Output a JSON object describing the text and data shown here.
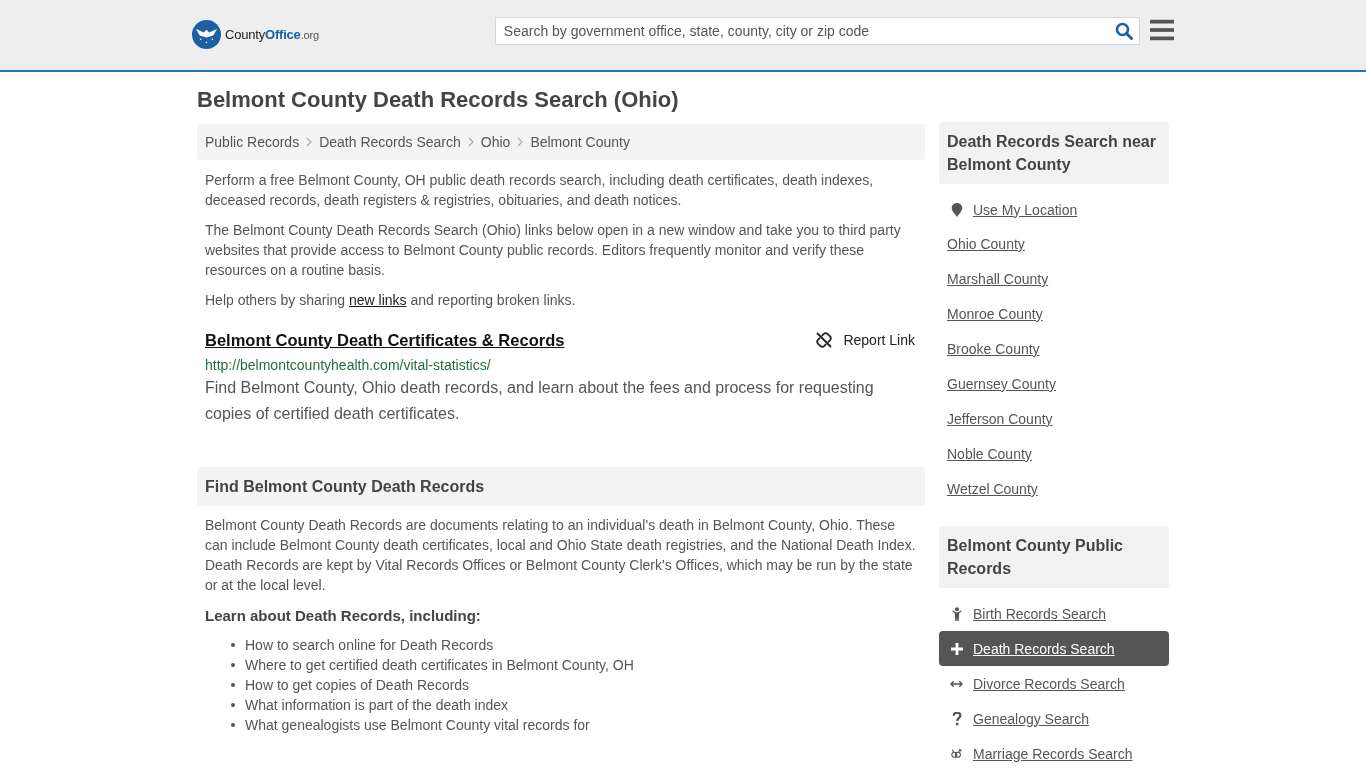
{
  "header": {
    "logo": {
      "parts": [
        {
          "text": "County",
          "kind": "plain"
        },
        {
          "text": "Office",
          "kind": "accent"
        },
        {
          "text": ".org",
          "kind": "suffix"
        }
      ]
    },
    "search": {
      "placeholder": "Search by government office, state, county, city or zip code"
    }
  },
  "page_title": "Belmont County Death Records Search (Ohio)",
  "breadcrumb": [
    "Public Records",
    "Death Records Search",
    "Ohio",
    "Belmont County"
  ],
  "intro": {
    "paragraphs": [
      "Perform a free Belmont County, OH public death records search, including death certificates, death indexes, deceased records, death registers & registries, obituaries, and death notices.",
      "The Belmont County Death Records Search (Ohio) links below open in a new window and take you to third party websites that provide access to Belmont County public records. Editors frequently monitor and verify these resources on a routine basis."
    ],
    "share_note": {
      "before": "Help others by sharing ",
      "link": "new links",
      "after": " and reporting broken links."
    }
  },
  "resources": [
    {
      "title": "Belmont County Death Certificates & Records",
      "url": "http://belmontcountyhealth.com/vital-statistics/",
      "description": "Find Belmont County, Ohio death records, and learn about the fees and process for requesting copies of certified death certificates.",
      "report_label": "Report Link"
    }
  ],
  "about": {
    "heading": "Find Belmont County Death Records",
    "paragraph": "Belmont County Death Records are documents relating to an individual's death in Belmont County, Ohio. These can include Belmont County death certificates, local and Ohio State death registries, and the National Death Index. Death Records are kept by Vital Records Offices or Belmont County Clerk's Offices, which may be run by the state or at the local level.",
    "subheading": "Learn about Death Records, including:",
    "bullets": [
      "How to search online for Death Records",
      "Where to get certified death certificates in Belmont County, OH",
      "How to get copies of Death Records",
      "What information is part of the death index",
      "What genealogists use Belmont County vital records for"
    ]
  },
  "sidebar": {
    "nearby": {
      "heading": "Death Records Search near Belmont County",
      "use_location": "Use My Location",
      "links": [
        "Ohio County",
        "Marshall County",
        "Monroe County",
        "Brooke County",
        "Guernsey County",
        "Jefferson County",
        "Noble County",
        "Wetzel County"
      ]
    },
    "public_records": {
      "heading": "Belmont County Public Records",
      "items": [
        {
          "label": "Birth Records Search",
          "kind": "birth",
          "selected": false
        },
        {
          "label": "Death Records Search",
          "kind": "death",
          "selected": true
        },
        {
          "label": "Divorce Records Search",
          "kind": "divorce",
          "selected": false
        },
        {
          "label": "Genealogy Search",
          "kind": "genealogy",
          "selected": false
        },
        {
          "label": "Marriage Records Search",
          "kind": "marriage",
          "selected": false
        }
      ]
    }
  }
}
